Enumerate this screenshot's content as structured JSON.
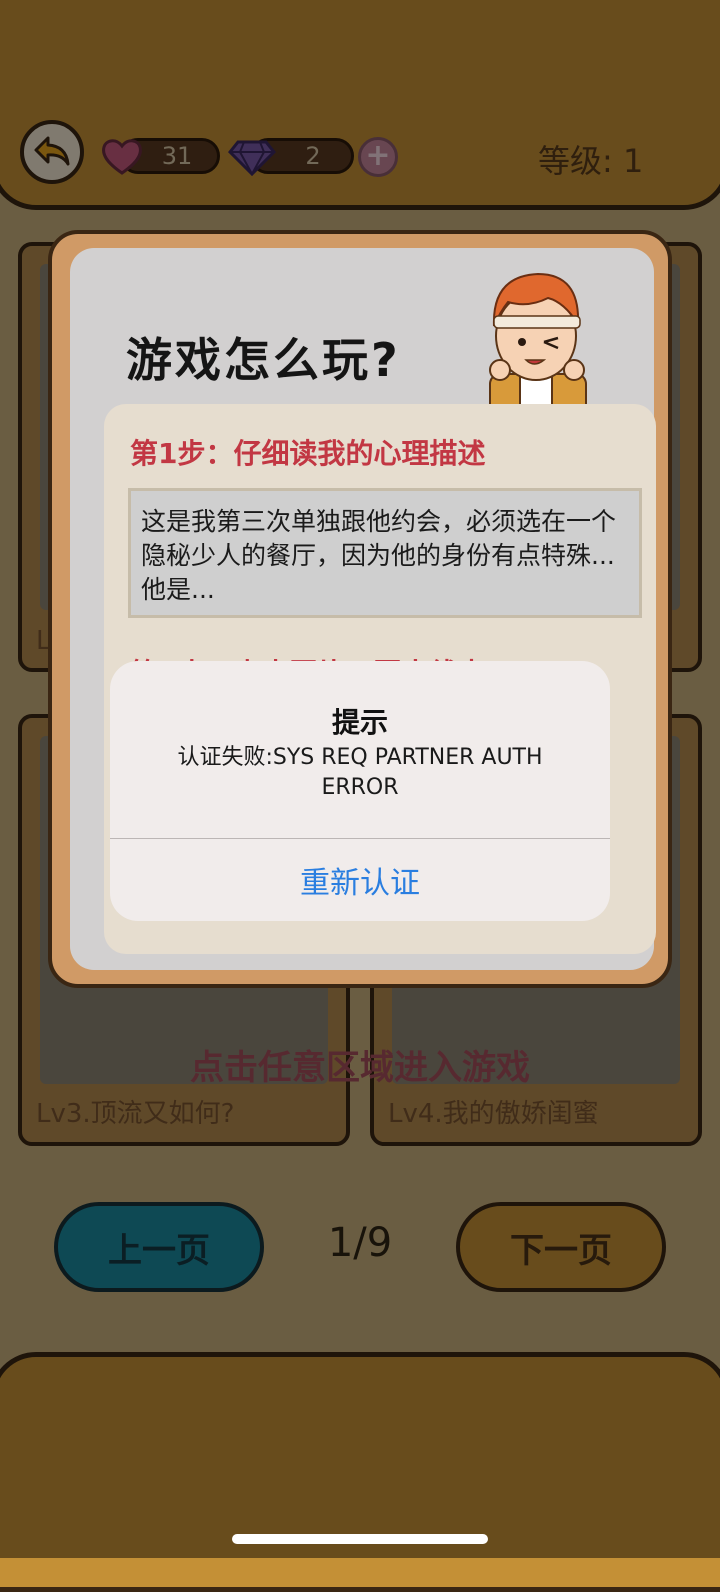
{
  "header": {
    "hearts_count": "31",
    "gems_count": "2",
    "add_symbol": "+",
    "level_label": "等级: 1"
  },
  "levels": {
    "cards": [
      {
        "caption": "Lv"
      },
      {
        "caption": ""
      },
      {
        "caption": "Lv3.顶流又如何?"
      },
      {
        "caption": "Lv4.我的傲娇闺蜜"
      }
    ],
    "enter_hint": "点击任意区域进入游戏"
  },
  "pagination": {
    "prev_label": "上一页",
    "next_label": "下一页",
    "indicator": "1/9"
  },
  "tutorial": {
    "title": "游戏怎么玩?",
    "step1_title": "第1步：仔细读我的心理描述",
    "step1_text": "这是我第三次单独跟他约会，必须选在一个隐秘少人的餐厅，因为他的身份有点特殊... 他是...",
    "step2_title": "第2步：点击图片，圈出线索"
  },
  "alert": {
    "title": "提示",
    "message": "认证失败:SYS REQ PARTNER AUTH ERROR",
    "button_label": "重新认证"
  },
  "colors": {
    "accent_brown": "#c49036",
    "step_title_red": "#c23743",
    "alert_button_blue": "#2a7ee0",
    "prev_button_teal": "#1b8a9f"
  }
}
